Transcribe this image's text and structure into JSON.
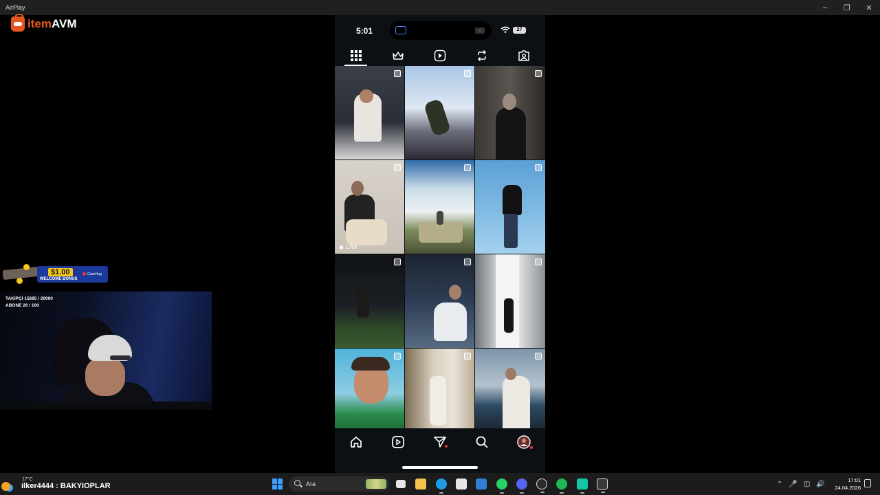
{
  "window": {
    "title": "AirPlay"
  },
  "logo": {
    "brand_part1": "item",
    "brand_part2": "AVM"
  },
  "promo": {
    "amount": "$1.00",
    "label": "WELCOME BONUS",
    "brand": "CaseHug"
  },
  "stream_stats": {
    "followers": "TAKİPÇİ 15685 / 20000",
    "subscribers": "ABONE 26 / 100"
  },
  "phone": {
    "status": {
      "time": "5:01",
      "battery": "27"
    },
    "profile_tabs": [
      {
        "name": "posts-grid",
        "icon": "grid-icon",
        "active": true
      },
      {
        "name": "crown",
        "icon": "crown-icon",
        "active": false
      },
      {
        "name": "reels",
        "icon": "reels-icon",
        "active": false
      },
      {
        "name": "reposts",
        "icon": "repost-icon",
        "active": false
      },
      {
        "name": "tagged",
        "icon": "tagged-icon",
        "active": false
      }
    ],
    "grid_posts": [
      {
        "indicator": "carousel",
        "views": ""
      },
      {
        "indicator": "carousel",
        "views": ""
      },
      {
        "indicator": "carousel",
        "views": ""
      },
      {
        "indicator": "reel",
        "views": "176K"
      },
      {
        "indicator": "carousel",
        "views": ""
      },
      {
        "indicator": "carousel",
        "views": ""
      },
      {
        "indicator": "carousel",
        "views": ""
      },
      {
        "indicator": "carousel",
        "views": ""
      },
      {
        "indicator": "carousel",
        "views": ""
      },
      {
        "indicator": "carousel",
        "views": ""
      },
      {
        "indicator": "carousel",
        "views": ""
      },
      {
        "indicator": "carousel",
        "views": ""
      }
    ],
    "bottom_nav": [
      "home-icon",
      "reels-icon",
      "messages-icon",
      "search-icon",
      "profile-avatar"
    ]
  },
  "chat": {
    "temperature": "17°C",
    "message": "ilker4444 : BAKYIOPLAR"
  },
  "taskbar": {
    "search_placeholder": "Ara",
    "time": "17:01",
    "date": "24.04.2026"
  },
  "colors": {
    "accent": "#e8561f",
    "notification": "#ff3040",
    "windows_blue": "#3aa0ff"
  }
}
